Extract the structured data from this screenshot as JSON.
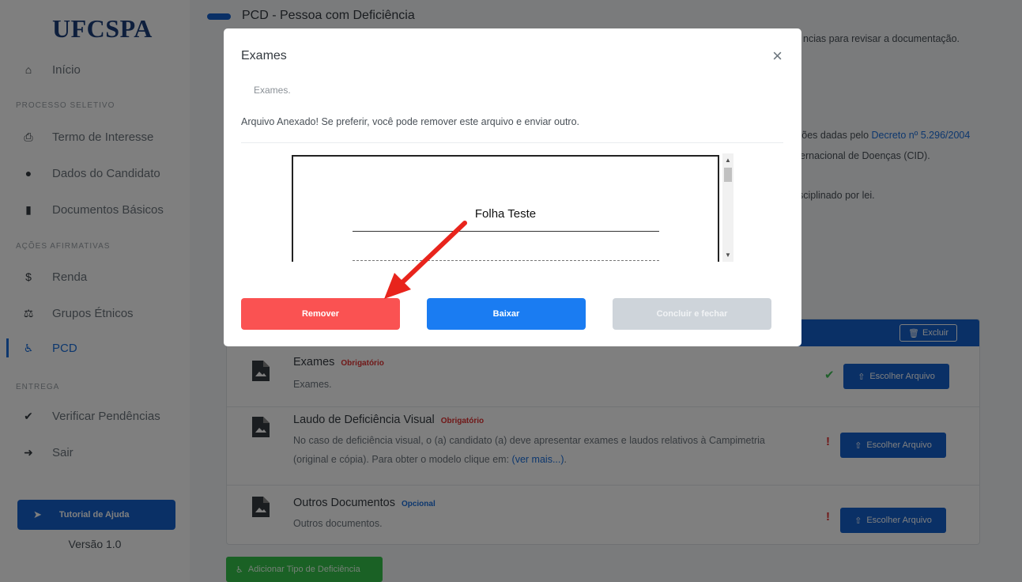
{
  "sidebar": {
    "logo": "UFCSPA",
    "home": "Início",
    "section_process": "PROCESSO SELETIVO",
    "items_process": [
      "Termo de Interesse",
      "Dados do Candidato",
      "Documentos Básicos"
    ],
    "section_affirmative": "AÇÕES AFIRMATIVAS",
    "items_affirmative": [
      "Renda",
      "Grupos Étnicos",
      "PCD"
    ],
    "section_delivery": "ENTREGA",
    "items_delivery": [
      "Verificar Pendências",
      "Sair"
    ],
    "tutorial": "Tutorial de Ajuda",
    "version": "Versão 1.0"
  },
  "main": {
    "page_title": "PCD - Pessoa com Deficiência",
    "bg_line1": "ncias para revisar a documentação.",
    "bg_line2_prefix": "ções dadas pelo ",
    "bg_line2_link": "Decreto nº 5.296/2004",
    "bg_line3": "ernacional de Doenças (CID).",
    "bg_line4": "sciplinado por lei.",
    "delete_label": "Excluir",
    "choose_label": "Escolher Arquivo",
    "documents": [
      {
        "title": "Exames",
        "badge": "Obrigatório",
        "desc1": "Exames.",
        "status": "check"
      },
      {
        "title": "Laudo de Deficiência Visual",
        "badge": "Obrigatório",
        "desc1": "No caso de deficiência visual, o (a) candidato (a) deve apresentar exames e laudos relativos à Campimetria",
        "desc2": "(original e cópia). Para obter o modelo clique em: ",
        "link": "(ver mais...)",
        "desc2_end": ".",
        "status": "!"
      },
      {
        "title": "Outros Documentos",
        "badge": "Opcional",
        "desc1": "Outros documentos.",
        "status": "!"
      }
    ],
    "add_type": "Adicionar Tipo de Deficiência"
  },
  "modal": {
    "title": "Exames",
    "close": "×",
    "subtitle": "Exames.",
    "message": "Arquivo Anexado! Se preferir, você pode remover este arquivo e enviar outro.",
    "preview_title": "Folha Teste",
    "buttons": {
      "remove": "Remover",
      "download": "Baixar",
      "finish": "Concluir e fechar"
    }
  },
  "colors": {
    "primary": "#1560cc",
    "danger": "#fa5252",
    "success": "#34c24a",
    "arrow": "#e8241c"
  }
}
